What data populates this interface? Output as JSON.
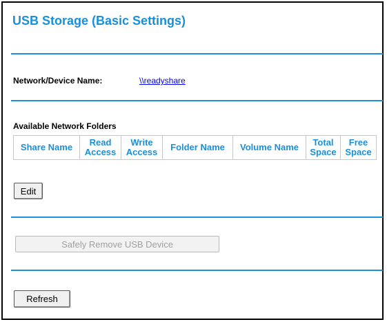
{
  "page": {
    "title": "USB Storage (Basic Settings)"
  },
  "device": {
    "label": "Network/Device Name:",
    "name_link": "\\\\readyshare"
  },
  "folders": {
    "heading": "Available Network Folders",
    "columns": [
      "Share Name",
      "Read Access",
      "Write Access",
      "Folder Name",
      "Volume Name",
      "Total Space",
      "Free Space"
    ]
  },
  "buttons": {
    "edit": "Edit",
    "safely_remove": "Safely Remove USB Device",
    "refresh": "Refresh"
  },
  "colors": {
    "accent": "#1a8fd8",
    "link": "#0000ee"
  }
}
